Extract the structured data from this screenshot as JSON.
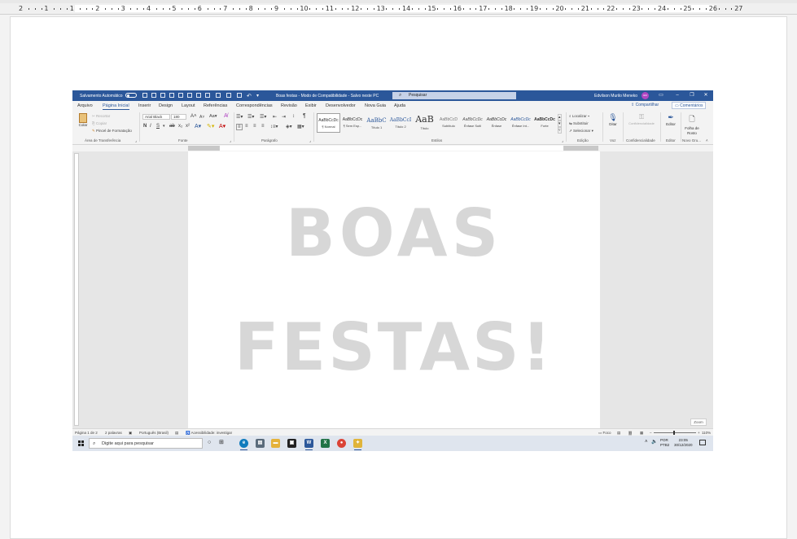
{
  "outer_ruler": {
    "numbers": [
      "2",
      "1",
      "1",
      "2",
      "3",
      "4",
      "5",
      "6",
      "7",
      "8",
      "9",
      "10",
      "11",
      "12",
      "13",
      "14",
      "15",
      "16",
      "17",
      "18",
      "19",
      "20",
      "21",
      "22",
      "23",
      "24",
      "25",
      "26",
      "27"
    ]
  },
  "titlebar": {
    "autosave_label": "Salvamento Automático",
    "doc_title": "Boas festas  -  Modo de Compatibilidade  -  Salvo neste PC",
    "search_placeholder": "Pesquisar",
    "user_name": "Edvilson Murilo Meneko",
    "user_initials": "EM"
  },
  "menu": {
    "items": [
      "Arquivo",
      "Página Inicial",
      "Inserir",
      "Design",
      "Layout",
      "Referências",
      "Correspondências",
      "Revisão",
      "Exibir",
      "Desenvolvedor",
      "Nova Guia",
      "Ajuda"
    ],
    "active": "Página Inicial",
    "share_label": "Compartilhar",
    "comments_label": "Comentários"
  },
  "ribbon": {
    "clipboard": {
      "paste_label": "Colar",
      "cut_label": "Recortar",
      "copy_label": "Copiar",
      "format_painter_label": "Pincel de Formatação",
      "group_label": "Área de Transferência"
    },
    "font": {
      "font_name": "Arial Black",
      "font_size": "180",
      "bold": "N",
      "italic": "I",
      "underline": "S",
      "group_label": "Fonte"
    },
    "paragraph": {
      "group_label": "Parágrafo"
    },
    "styles": {
      "group_label": "Estilos",
      "items": [
        {
          "sample": "AaBbCcDc",
          "name": "¶ Normal"
        },
        {
          "sample": "AaBbCcDc",
          "name": "¶ Sem Esp..."
        },
        {
          "sample": "AaBbC",
          "name": "Título 1"
        },
        {
          "sample": "AaBbCcI",
          "name": "Título 2"
        },
        {
          "sample": "AaB",
          "name": "Título"
        },
        {
          "sample": "AaBbCcD",
          "name": "Subtítulo"
        },
        {
          "sample": "AaBbCcDc",
          "name": "Ênfase Sutil"
        },
        {
          "sample": "AaBbCcDc",
          "name": "Ênfase"
        },
        {
          "sample": "AaBbCcDc",
          "name": "Ênfase Int..."
        },
        {
          "sample": "AaBbCcDc",
          "name": "Forte"
        }
      ]
    },
    "editing": {
      "find_label": "Localizar",
      "replace_label": "Substituir",
      "select_label": "Selecionar",
      "group_label": "Edição"
    },
    "voice": {
      "dictate_label": "Ditar",
      "group_label": "Voz"
    },
    "sensitivity": {
      "label": "Confidencialidade",
      "group_label": "Confidencialidade"
    },
    "editor": {
      "label": "Editor",
      "group_label": "Editor"
    },
    "new_group": {
      "label": "Folha de Rosto",
      "group_label": "Novo Gru..."
    }
  },
  "document": {
    "line1": "BOAS",
    "line2": "FESTAS!",
    "zoom_badge": "Zoom"
  },
  "statusbar": {
    "page": "Página 1 de 2",
    "words": "2 palavras",
    "language": "Português (Brasil)",
    "accessibility": "Acessibilidade: investigar",
    "focus": "Foco",
    "zoom": "110%"
  },
  "taskbar": {
    "search_placeholder": "Digite aqui para pesquisar",
    "lang_line1": "POR",
    "lang_line2": "PTB2",
    "time": "23:05",
    "date": "30/12/2020"
  },
  "colors": {
    "word_blue": "#2b579a",
    "watermark_gray": "#d7d7d7"
  }
}
